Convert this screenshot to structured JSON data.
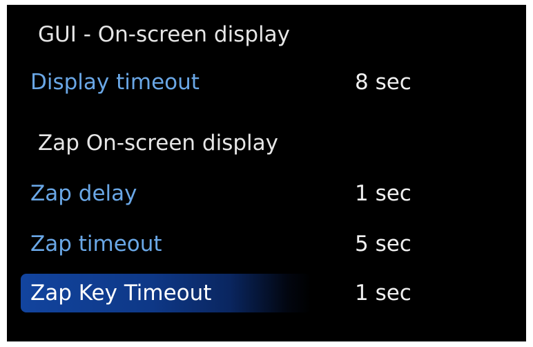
{
  "sections": [
    {
      "title": "GUI - On-screen display",
      "items": [
        {
          "label": "Display timeout",
          "value": "8 sec",
          "selected": false
        }
      ]
    },
    {
      "title": "Zap On-screen display",
      "items": [
        {
          "label": "Zap delay",
          "value": "1 sec",
          "selected": false
        },
        {
          "label": "Zap timeout",
          "value": "5 sec",
          "selected": false
        },
        {
          "label": "Zap Key Timeout",
          "value": "1 sec",
          "selected": true
        }
      ]
    }
  ],
  "colors": {
    "background": "#000000",
    "section_title": "#e6e6e6",
    "item_label": "#6aa7e6",
    "item_value": "#f0f0f0",
    "selection_highlight": "#12449e"
  }
}
